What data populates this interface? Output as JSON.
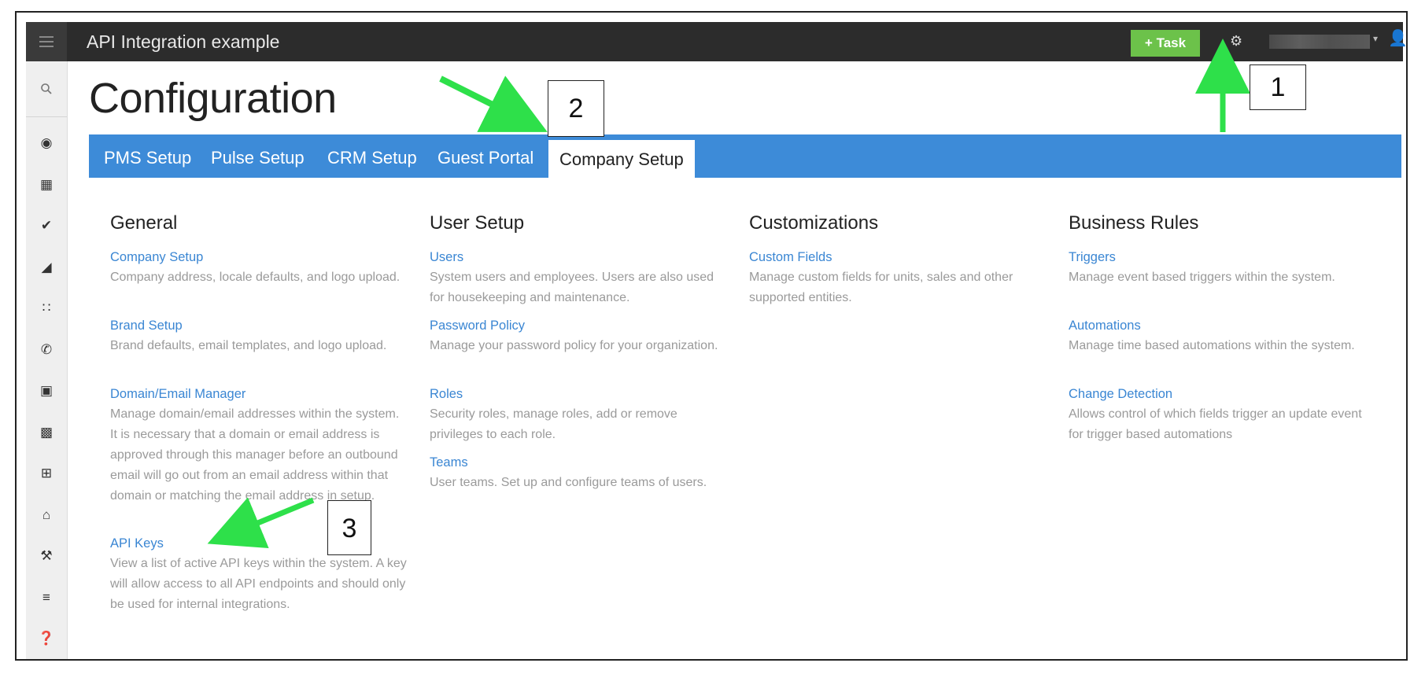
{
  "app": {
    "title": "API Integration example"
  },
  "header": {
    "task_button": "+ Task"
  },
  "page": {
    "title": "Configuration"
  },
  "tabs": [
    {
      "label": "PMS Setup"
    },
    {
      "label": "Pulse Setup"
    },
    {
      "label": "CRM Setup"
    },
    {
      "label": "Guest Portal"
    },
    {
      "label": "Company Setup"
    }
  ],
  "columns": {
    "general": {
      "heading": "General",
      "items": [
        {
          "link": "Company Setup",
          "desc": "Company address, locale defaults, and logo upload."
        },
        {
          "link": "Brand Setup",
          "desc": "Brand defaults, email templates, and logo upload."
        },
        {
          "link": "Domain/Email Manager",
          "desc": "Manage domain/email addresses within the system. It is necessary that a domain or email address is approved through this manager before an outbound email will go out from an email address within that domain or matching the email address in setup."
        },
        {
          "link": "API Keys",
          "desc": "View a list of active API keys within the system. A key will allow access to all API endpoints and should only be used for internal integrations."
        }
      ]
    },
    "user_setup": {
      "heading": "User Setup",
      "items": [
        {
          "link": "Users",
          "desc": "System users and employees. Users are also used for housekeeping and maintenance."
        },
        {
          "link": "Password Policy",
          "desc": "Manage your password policy for your organization."
        },
        {
          "link": "Roles",
          "desc": "Security roles, manage roles, add or remove privileges to each role."
        },
        {
          "link": "Teams",
          "desc": "User teams. Set up and configure teams of users."
        }
      ]
    },
    "customizations": {
      "heading": "Customizations",
      "items": [
        {
          "link": "Custom Fields",
          "desc": "Manage custom fields for units, sales and other supported entities."
        }
      ]
    },
    "business_rules": {
      "heading": "Business Rules",
      "items": [
        {
          "link": "Triggers",
          "desc": "Manage event based triggers within the system."
        },
        {
          "link": "Automations",
          "desc": "Manage time based automations within the system."
        },
        {
          "link": "Change Detection",
          "desc": "Allows control of which fields trigger an update event for trigger based automations"
        }
      ]
    }
  },
  "callouts": {
    "one": "1",
    "two": "2",
    "three": "3"
  },
  "sidebar_icons": [
    "dashboard-icon",
    "calendar-icon",
    "check-circle-icon",
    "area-chart-icon",
    "group-icon",
    "phone-icon",
    "money-icon",
    "briefcase-icon",
    "grid-icon",
    "home-icon",
    "wrench-icon",
    "bar-chart-icon",
    "help-icon"
  ],
  "colors": {
    "accent_blue": "#3d8bd8",
    "link_blue": "#3a86d3",
    "task_green": "#6cc24a",
    "arrow_green": "#2ee04a"
  }
}
